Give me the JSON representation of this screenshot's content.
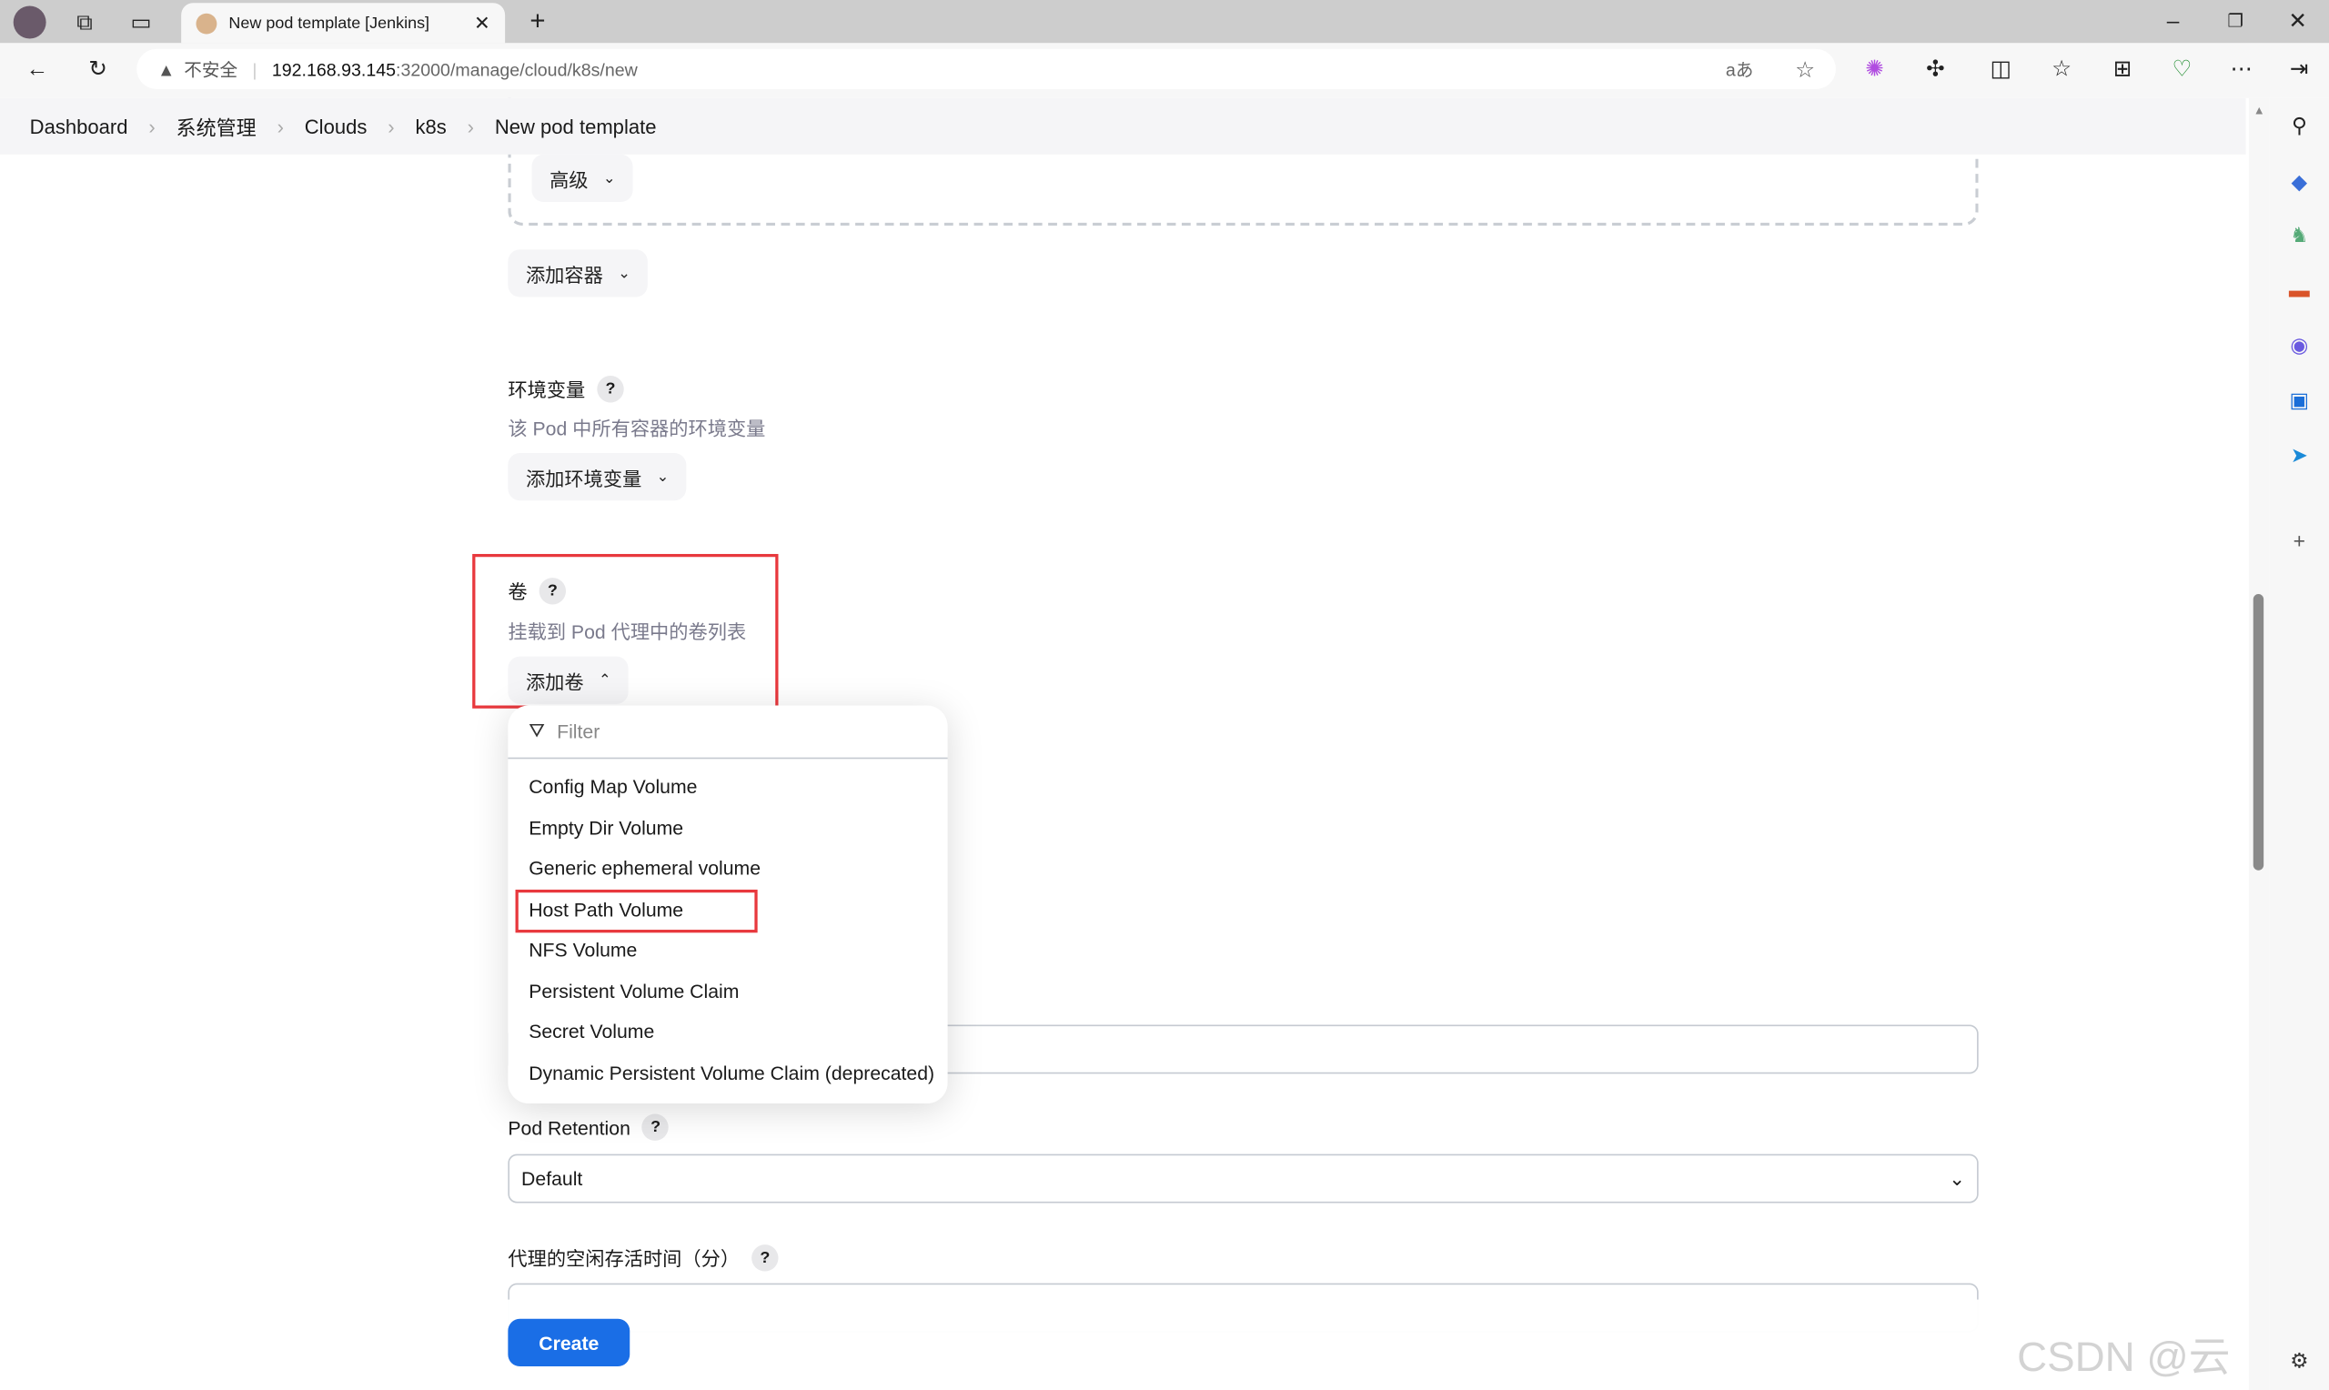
{
  "browser": {
    "tab_title": "New pod template [Jenkins]",
    "url_warning": "不安全",
    "url_host": "192.168.93.145",
    "url_rest": ":32000/manage/cloud/k8s/new",
    "accent": "#1a6ee6"
  },
  "breadcrumb": [
    "Dashboard",
    "系统管理",
    "Clouds",
    "k8s",
    "New pod template"
  ],
  "form": {
    "advanced_label": "高级",
    "add_container_label": "添加容器",
    "env": {
      "label": "环境变量",
      "help": "?",
      "description": "该 Pod 中所有容器的环境变量",
      "button": "添加环境变量"
    },
    "volumes": {
      "label": "卷",
      "help": "?",
      "description": "挂载到 Pod 代理中的卷列表",
      "button": "添加卷"
    },
    "volume_menu": {
      "filter_placeholder": "Filter",
      "items": [
        "Config Map Volume",
        "Empty Dir Volume",
        "Generic ephemeral volume",
        "Host Path Volume",
        "NFS Volume",
        "Persistent Volume Claim",
        "Secret Volume",
        "Dynamic Persistent Volume Claim (deprecated)"
      ],
      "highlighted": "Host Path Volume"
    },
    "pod_retention": {
      "label": "Pod Retention",
      "help": "?",
      "value": "Default"
    },
    "idle_minutes": {
      "label": "代理的空闲存活时间（分）",
      "help": "?"
    },
    "create_label": "Create"
  },
  "watermark": "CSDN @云教员"
}
